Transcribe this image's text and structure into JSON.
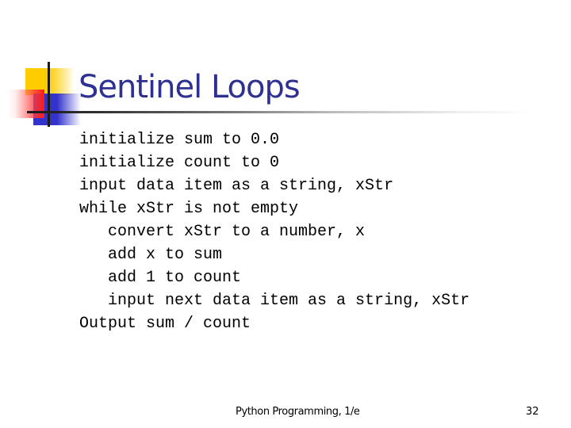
{
  "slide": {
    "title": "Sentinel Loops",
    "code_lines": [
      "initialize sum to 0.0",
      "initialize count to 0",
      "input data item as a string, xStr",
      "while xStr is not empty",
      "   convert xStr to a number, x",
      "   add x to sum",
      "   add 1 to count",
      "   input next data item as a string, xStr",
      "Output sum / count"
    ],
    "footer": "Python Programming, 1/e",
    "page_number": "32"
  },
  "colors": {
    "title": "#2e3192",
    "accent_yellow": "#ffcc00",
    "accent_blue": "#3333cc",
    "accent_red": "#ff1a1a"
  }
}
